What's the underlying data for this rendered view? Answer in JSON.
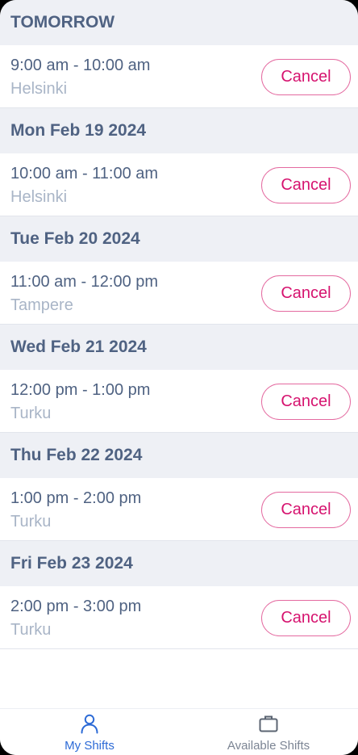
{
  "schedule": [
    {
      "date_label": "TOMORROW",
      "time": "9:00 am - 10:00 am",
      "location": "Helsinki",
      "action_label": "Cancel"
    },
    {
      "date_label": "Mon Feb 19 2024",
      "time": "10:00 am - 11:00 am",
      "location": "Helsinki",
      "action_label": "Cancel"
    },
    {
      "date_label": "Tue Feb 20 2024",
      "time": "11:00 am - 12:00 pm",
      "location": "Tampere",
      "action_label": "Cancel"
    },
    {
      "date_label": "Wed Feb 21 2024",
      "time": "12:00 pm - 1:00 pm",
      "location": "Turku",
      "action_label": "Cancel"
    },
    {
      "date_label": "Thu Feb 22 2024",
      "time": "1:00 pm - 2:00 pm",
      "location": "Turku",
      "action_label": "Cancel"
    },
    {
      "date_label": "Fri Feb 23 2024",
      "time": "2:00 pm - 3:00 pm",
      "location": "Turku",
      "action_label": "Cancel"
    }
  ],
  "bottom_nav": {
    "items": [
      {
        "label": "My Shifts",
        "icon": "person-icon",
        "active": true
      },
      {
        "label": "Available Shifts",
        "icon": "briefcase-icon",
        "active": false
      }
    ]
  },
  "colors": {
    "accent": "#d6136f",
    "nav_active": "#2c6ad6",
    "header_text": "#4f6282"
  }
}
